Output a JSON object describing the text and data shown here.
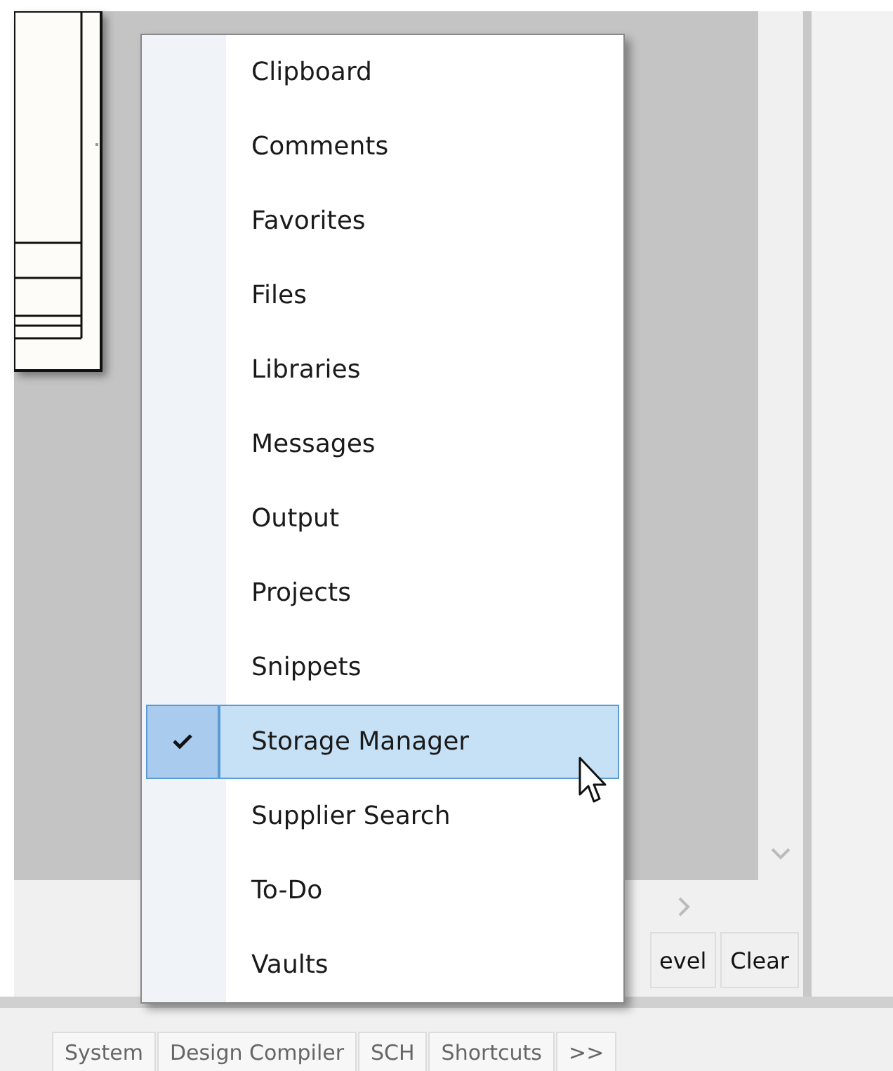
{
  "menu": {
    "items": [
      {
        "label": "Clipboard",
        "checked": false,
        "hovered": false
      },
      {
        "label": "Comments",
        "checked": false,
        "hovered": false
      },
      {
        "label": "Favorites",
        "checked": false,
        "hovered": false
      },
      {
        "label": "Files",
        "checked": false,
        "hovered": false
      },
      {
        "label": "Libraries",
        "checked": false,
        "hovered": false
      },
      {
        "label": "Messages",
        "checked": false,
        "hovered": false
      },
      {
        "label": "Output",
        "checked": false,
        "hovered": false
      },
      {
        "label": "Projects",
        "checked": false,
        "hovered": false
      },
      {
        "label": "Snippets",
        "checked": false,
        "hovered": false
      },
      {
        "label": "Storage Manager",
        "checked": true,
        "hovered": true
      },
      {
        "label": "Supplier Search",
        "checked": false,
        "hovered": false
      },
      {
        "label": "To-Do",
        "checked": false,
        "hovered": false
      },
      {
        "label": "Vaults",
        "checked": false,
        "hovered": false
      }
    ]
  },
  "panel_buttons": [
    "evel",
    "Clear"
  ],
  "status_tabs": [
    "System",
    "Design Compiler",
    "SCH",
    "Shortcuts",
    ">>"
  ]
}
